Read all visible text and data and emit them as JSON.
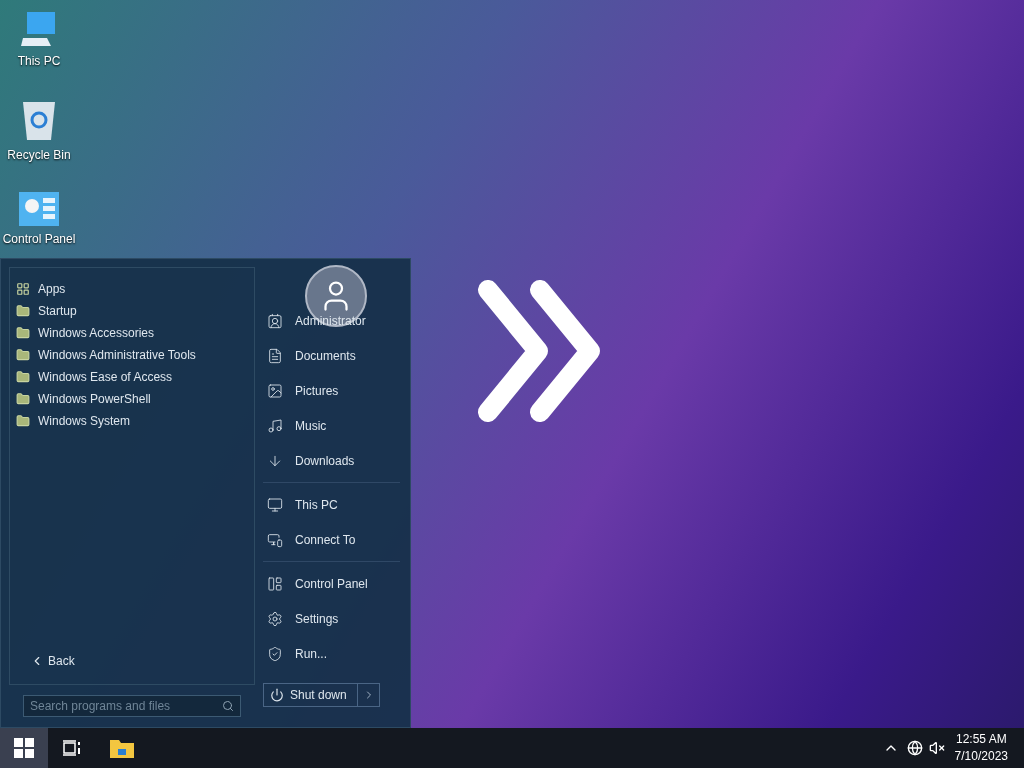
{
  "desktop_icons": [
    {
      "kind": "pc",
      "label": "This PC"
    },
    {
      "kind": "bin",
      "label": "Recycle Bin"
    },
    {
      "kind": "panel",
      "label": "Control Panel"
    }
  ],
  "start_menu": {
    "programs": [
      {
        "kind": "apps",
        "label": "Apps"
      },
      {
        "kind": "folder",
        "label": "Startup"
      },
      {
        "kind": "folder",
        "label": "Windows Accessories"
      },
      {
        "kind": "folder",
        "label": "Windows Administrative Tools"
      },
      {
        "kind": "folder",
        "label": "Windows Ease of Access"
      },
      {
        "kind": "folder",
        "label": "Windows PowerShell"
      },
      {
        "kind": "folder",
        "label": "Windows System"
      }
    ],
    "back": "Back",
    "search": {
      "placeholder": "Search programs and files"
    },
    "groups": [
      [
        {
          "kind": "user",
          "label": "Administrator"
        },
        {
          "kind": "documents",
          "label": "Documents"
        },
        {
          "kind": "pictures",
          "label": "Pictures"
        },
        {
          "kind": "music",
          "label": "Music"
        },
        {
          "kind": "downloads",
          "label": "Downloads"
        }
      ],
      [
        {
          "kind": "pc",
          "label": "This PC"
        },
        {
          "kind": "connect",
          "label": "Connect To"
        }
      ],
      [
        {
          "kind": "panel",
          "label": "Control Panel"
        },
        {
          "kind": "settings",
          "label": "Settings"
        },
        {
          "kind": "run",
          "label": "Run..."
        }
      ]
    ],
    "shutdown": "Shut down"
  },
  "clock": {
    "time": "12:55 AM",
    "date": "7/10/2023"
  }
}
